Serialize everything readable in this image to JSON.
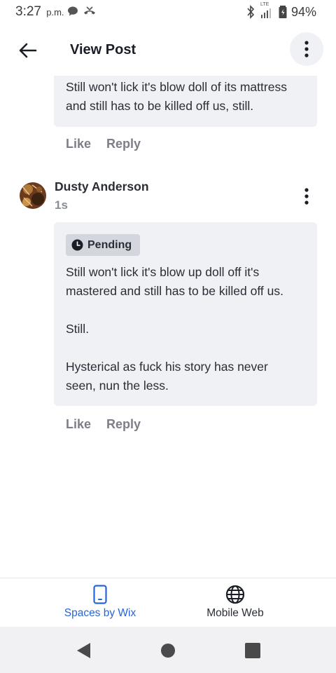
{
  "status_bar": {
    "time": "3:27",
    "ampm": "p.m.",
    "network": "LTE",
    "battery": "94%"
  },
  "header": {
    "title": "View Post"
  },
  "previous_comment": {
    "text": "Still won't lick it's blow doll of its mattress\nand still has to be killed off us, still.",
    "like_label": "Like",
    "reply_label": "Reply"
  },
  "comment": {
    "author": "Dusty Anderson",
    "time": "1s",
    "status": "Pending",
    "text": "Still won't lick it's blow up doll off it's\nmastered and still has to be killed off us.\n\nStill.\n\nHysterical as fuck his story has never\nseen, nun the less.",
    "like_label": "Like",
    "reply_label": "Reply"
  },
  "bottom_nav": {
    "items": [
      {
        "label": "Spaces by Wix",
        "icon": "phone-icon",
        "active": true
      },
      {
        "label": "Mobile Web",
        "icon": "globe-icon",
        "active": false
      }
    ]
  },
  "colors": {
    "accent": "#2764d8",
    "bubble": "#f0f1f5",
    "badge": "#d4d6de"
  }
}
